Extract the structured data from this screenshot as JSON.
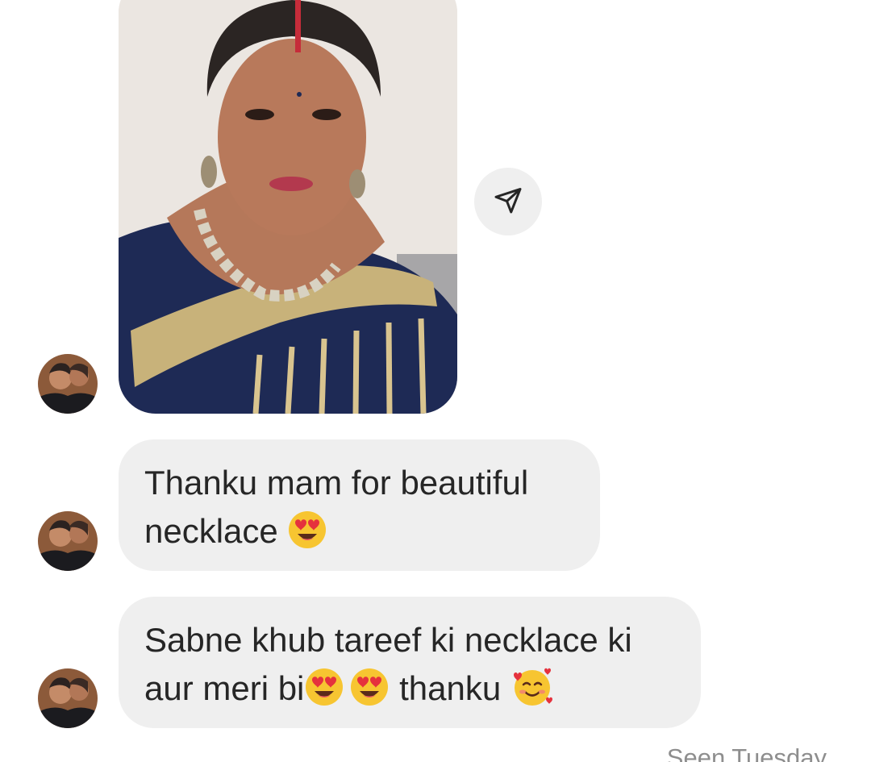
{
  "thread": {
    "shared_photo": {
      "description_icon": "shared-photo",
      "share_icon": "paper-plane-icon"
    },
    "messages": [
      {
        "line1": "Thanku mam for beautiful",
        "line2_text": "necklace",
        "line2_emoji": "heart-eyes-emoji"
      },
      {
        "line1": "Sabne khub tareef ki necklace ki",
        "line2_text_a": "aur meri bi",
        "line2_text_b": "thanku",
        "emojis": [
          "heart-eyes-emoji",
          "heart-eyes-emoji",
          "smiling-face-with-hearts-emoji"
        ]
      }
    ],
    "seen_receipt": "Seen Tuesday"
  },
  "colors": {
    "bubble_bg": "#efefef",
    "text": "#262626",
    "receipt": "#8e8e8e"
  }
}
